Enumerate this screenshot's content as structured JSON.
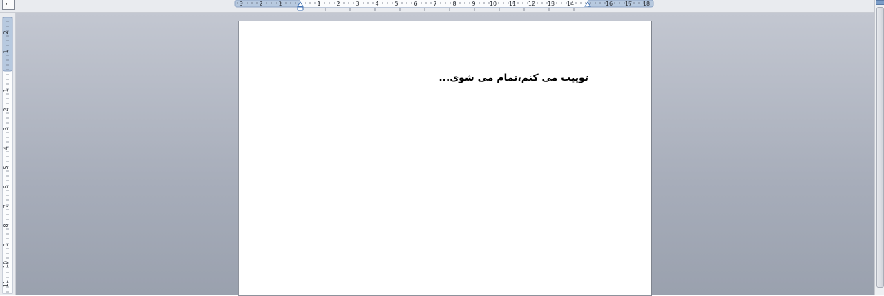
{
  "ruler": {
    "tab_selector_glyph": "⌐",
    "horizontal_labels": [
      "3",
      "2",
      "1",
      "1",
      "2",
      "3",
      "4",
      "5",
      "6",
      "7",
      "8",
      "9",
      "10",
      "11",
      "12",
      "13",
      "14",
      "16",
      "17",
      "18"
    ],
    "vertical_labels": [
      "2",
      "1",
      "1",
      "2",
      "3",
      "4",
      "5",
      "6",
      "7",
      "8",
      "9",
      "10",
      "11"
    ]
  },
  "document": {
    "line1": "توییت می کنم،تمام می شوی..."
  },
  "colors": {
    "ruler_margin": "#b7c9df",
    "ruler_work": "#fbfcfd",
    "indent_marker": "#3f6fb0"
  }
}
